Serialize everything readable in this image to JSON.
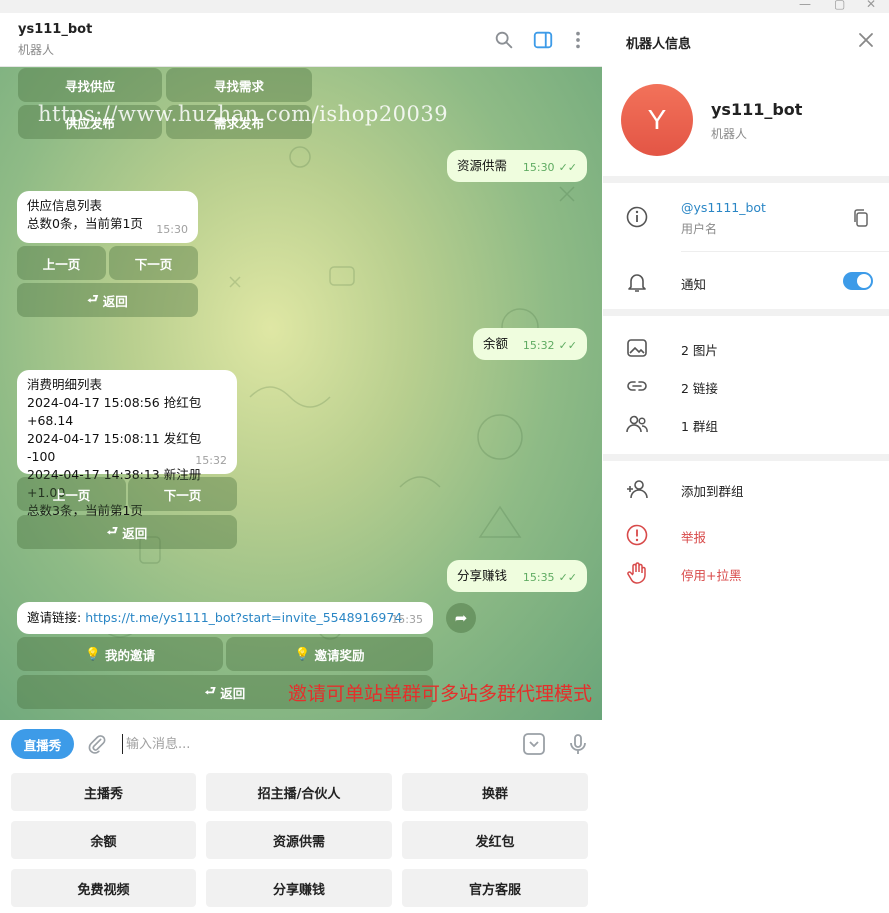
{
  "chat": {
    "title": "ys111_bot",
    "subtitle": "机器人"
  },
  "watermark": "https://www.huzhan.com/ishop20039",
  "promo_text": "邀请可单站单群可多站多群代理模式",
  "messages": {
    "top_buttons": [
      "寻找供应",
      "寻找需求",
      "供应发布",
      "需求发布"
    ],
    "out1": {
      "text": "资源供需",
      "time": "15:30"
    },
    "in1": {
      "lines": [
        "供应信息列表",
        "总数0条，当前第1页"
      ],
      "time": "15:30",
      "buttons": [
        "上一页",
        "下一页"
      ],
      "back": "返回"
    },
    "out2": {
      "text": "余额",
      "time": "15:32"
    },
    "in2": {
      "lines": [
        "消费明细列表",
        "2024-04-17 15:08:56 抢红包 +68.14",
        "2024-04-17 15:08:11 发红包 -100",
        "2024-04-17 14:38:13 新注册 +1.00",
        "总数3条，当前第1页"
      ],
      "time": "15:32",
      "buttons": [
        "上一页",
        "下一页"
      ],
      "back": "返回"
    },
    "out3": {
      "text": "分享赚钱",
      "time": "15:35"
    },
    "in3": {
      "label": "邀请链接: ",
      "link": "https://t.me/ys1111_bot?start=invite_5548916974",
      "time": "15:35",
      "buttons": [
        "我的邀请",
        "邀请奖励"
      ],
      "back": "返回"
    }
  },
  "composer": {
    "live_button": "直播秀",
    "placeholder": "输入消息..."
  },
  "reply_keyboard": [
    [
      "主播秀",
      "招主播/合伙人",
      "换群"
    ],
    [
      "余额",
      "资源供需",
      "发红包"
    ],
    [
      "免费视频",
      "分享赚钱",
      "官方客服"
    ]
  ],
  "info": {
    "title": "机器人信息",
    "avatar_letter": "Y",
    "name": "ys111_bot",
    "type": "机器人",
    "username": "@ys1111_bot",
    "username_label": "用户名",
    "notifications": "通知",
    "notifications_on": true,
    "media": [
      "2 图片",
      "2 链接",
      "1 群组"
    ],
    "actions": {
      "add_to_group": "添加到群组",
      "report": "举报",
      "block": "停用+拉黑"
    }
  },
  "colors": {
    "accent": "#3d9be8",
    "danger": "#d84a4a",
    "out_bubble": "#effdde",
    "promo": "#e3302c"
  }
}
